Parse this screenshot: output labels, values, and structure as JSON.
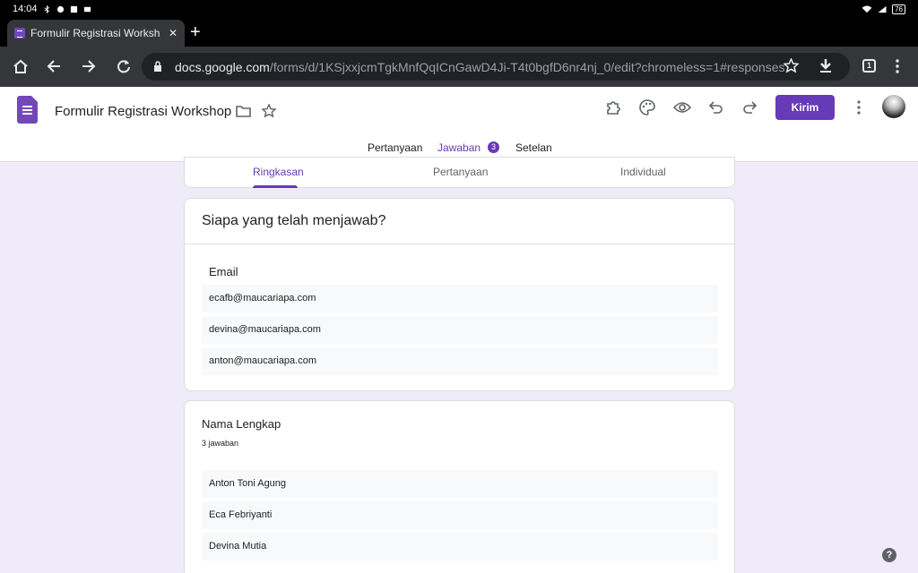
{
  "status_bar": {
    "time": "14:04",
    "battery": "76"
  },
  "browser": {
    "tab_title": "Formulir Registrasi Workshop",
    "tab_count": "1",
    "url_host": "docs.google.com",
    "url_path": "/forms/d/1KSjxxjcmTgkMnfQqICnGawD4Ji-T4t0bgfD6nr4nj_0/edit?chromeless=1#responses"
  },
  "form": {
    "title": "Formulir Registrasi Workshop",
    "send_label": "Kirim",
    "main_tabs": [
      {
        "label": "Pertanyaan"
      },
      {
        "label": "Jawaban",
        "badge": "3"
      },
      {
        "label": "Setelan"
      }
    ],
    "sub_tabs": [
      {
        "label": "Ringkasan"
      },
      {
        "label": "Pertanyaan"
      },
      {
        "label": "Individual"
      }
    ]
  },
  "responders": {
    "title": "Siapa yang telah menjawab?",
    "field_label": "Email",
    "emails": [
      "ecafb@maucariapa.com",
      "devina@maucariapa.com",
      "anton@maucariapa.com"
    ]
  },
  "question": {
    "title": "Nama Lengkap",
    "count": "3 jawaban",
    "answers": [
      "Anton Toni Agung",
      "Eca Febriyanti",
      "Devina Mutia"
    ]
  },
  "colors": {
    "accent": "#673ab7",
    "page_bg": "#f0ebf8"
  }
}
